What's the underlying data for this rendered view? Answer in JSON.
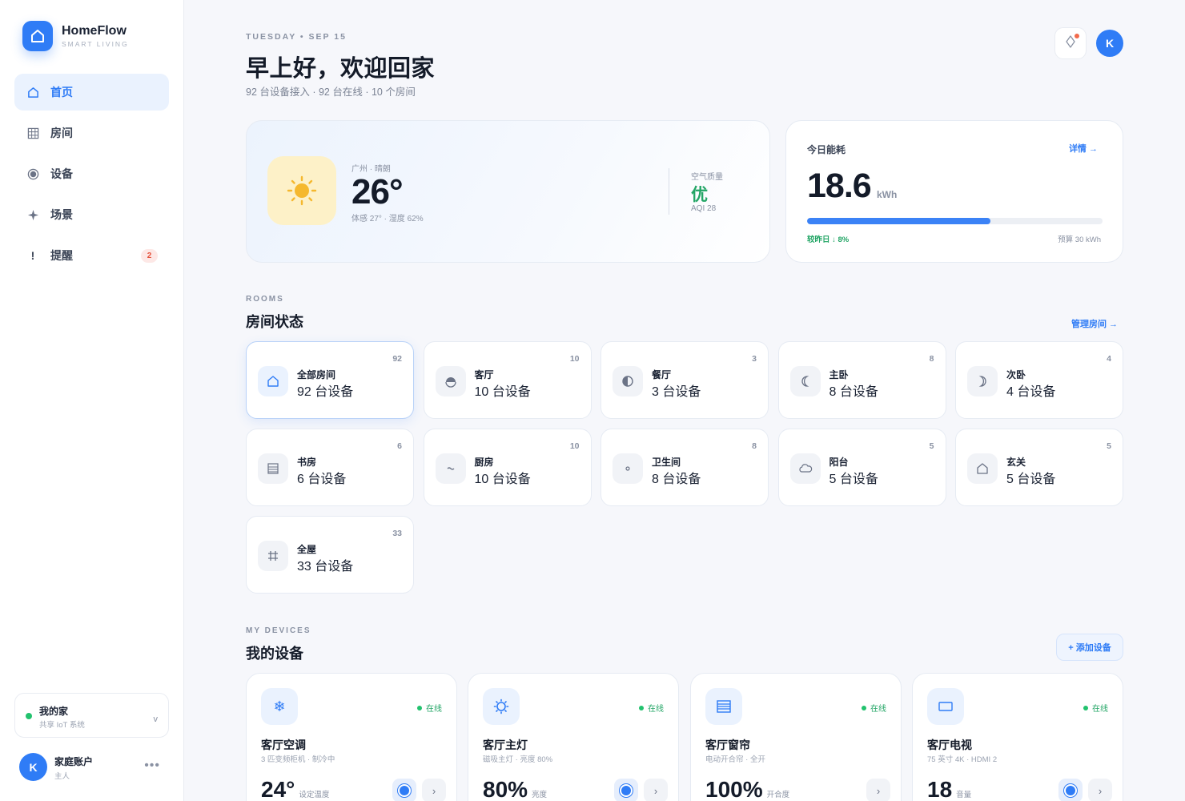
{
  "brand": {
    "name": "HomeFlow",
    "tagline": "SMART LIVING",
    "icon": "home-icon"
  },
  "nav": [
    {
      "label": "首页",
      "icon": "home-outline-icon",
      "active": true
    },
    {
      "label": "房间",
      "icon": "grid-icon",
      "active": false
    },
    {
      "label": "设备",
      "icon": "device-dot-icon",
      "active": false
    },
    {
      "label": "场景",
      "icon": "sparkle-icon",
      "active": false
    },
    {
      "label": "提醒",
      "icon": "alert-icon",
      "active": false,
      "badge": "2"
    }
  ],
  "home_selector": {
    "name": "我的家",
    "subtitle": "共享 IoT 系统",
    "status_color": "#22c26e"
  },
  "account": {
    "avatar": "K",
    "name": "家庭账户",
    "role": "主人",
    "more": "•••"
  },
  "header": {
    "date": "TUESDAY • SEP 15",
    "greeting": "早上好，欢迎回家",
    "summary": "92 台设备接入 · 92 台在线 · 10 个房间",
    "avatar": "K"
  },
  "weather": {
    "location": "广州 · 晴朗",
    "temperature": "26°",
    "details": "体感 27° · 湿度 62%",
    "air_quality_label": "空气质量",
    "air_quality_value": "优",
    "aqi": "AQI 28",
    "icon": "sun-icon"
  },
  "energy": {
    "title": "今日能耗",
    "link": "详情 →",
    "value": "18.6",
    "unit": "kWh",
    "progress": 0.62,
    "comparison": "较昨日 ↓ 8%",
    "budget": "预算 30 kWh"
  },
  "rooms_section": {
    "eyebrow": "ROOMS",
    "title": "房间状态",
    "link": "管理房间 →"
  },
  "rooms": [
    {
      "name": "全部房间",
      "count": "92 台设备",
      "num": "92",
      "icon": "home-outline-icon",
      "selected": true
    },
    {
      "name": "客厅",
      "count": "10 台设备",
      "num": "10",
      "icon": "sofa-icon"
    },
    {
      "name": "餐厅",
      "count": "3 台设备",
      "num": "3",
      "icon": "half-circle-icon"
    },
    {
      "name": "主卧",
      "count": "8 台设备",
      "num": "8",
      "icon": "moon-icon"
    },
    {
      "name": "次卧",
      "count": "4 台设备",
      "num": "4",
      "icon": "moon-small-icon"
    },
    {
      "name": "书房",
      "count": "6 台设备",
      "num": "6",
      "icon": "book-icon"
    },
    {
      "name": "厨房",
      "count": "10 台设备",
      "num": "10",
      "icon": "wave-icon"
    },
    {
      "name": "卫生间",
      "count": "8 台设备",
      "num": "8",
      "icon": "drop-icon"
    },
    {
      "name": "阳台",
      "count": "5 台设备",
      "num": "5",
      "icon": "cloud-icon"
    },
    {
      "name": "玄关",
      "count": "5 台设备",
      "num": "5",
      "icon": "door-icon"
    },
    {
      "name": "全屋",
      "count": "33 台设备",
      "num": "33",
      "icon": "hash-icon"
    }
  ],
  "devices_section": {
    "eyebrow": "MY DEVICES",
    "title": "我的设备",
    "add_label": "+ 添加设备"
  },
  "devices": [
    {
      "name": "客厅空调",
      "desc": "3 匹变频柜机 · 制冷中",
      "value": "24°",
      "unit": "设定温度",
      "status": "在线",
      "icon": "snowflake-icon",
      "has_toggle": true
    },
    {
      "name": "客厅主灯",
      "desc": "磁吸主灯 · 亮度 80%",
      "value": "80%",
      "unit": "亮度",
      "status": "在线",
      "icon": "bulb-icon",
      "has_toggle": true
    },
    {
      "name": "客厅窗帘",
      "desc": "电动开合帘 · 全开",
      "value": "100%",
      "unit": "开合度",
      "status": "在线",
      "icon": "curtain-icon",
      "has_toggle": false
    },
    {
      "name": "客厅电视",
      "desc": "75 英寸 4K · HDMI 2",
      "value": "18",
      "unit": "音量",
      "status": "在线",
      "icon": "tv-icon",
      "has_toggle": true
    }
  ],
  "colors": {
    "accent": "#2f7cf6",
    "success": "#22a565",
    "alert": "#e5533d",
    "sun": "#f5b82e"
  }
}
